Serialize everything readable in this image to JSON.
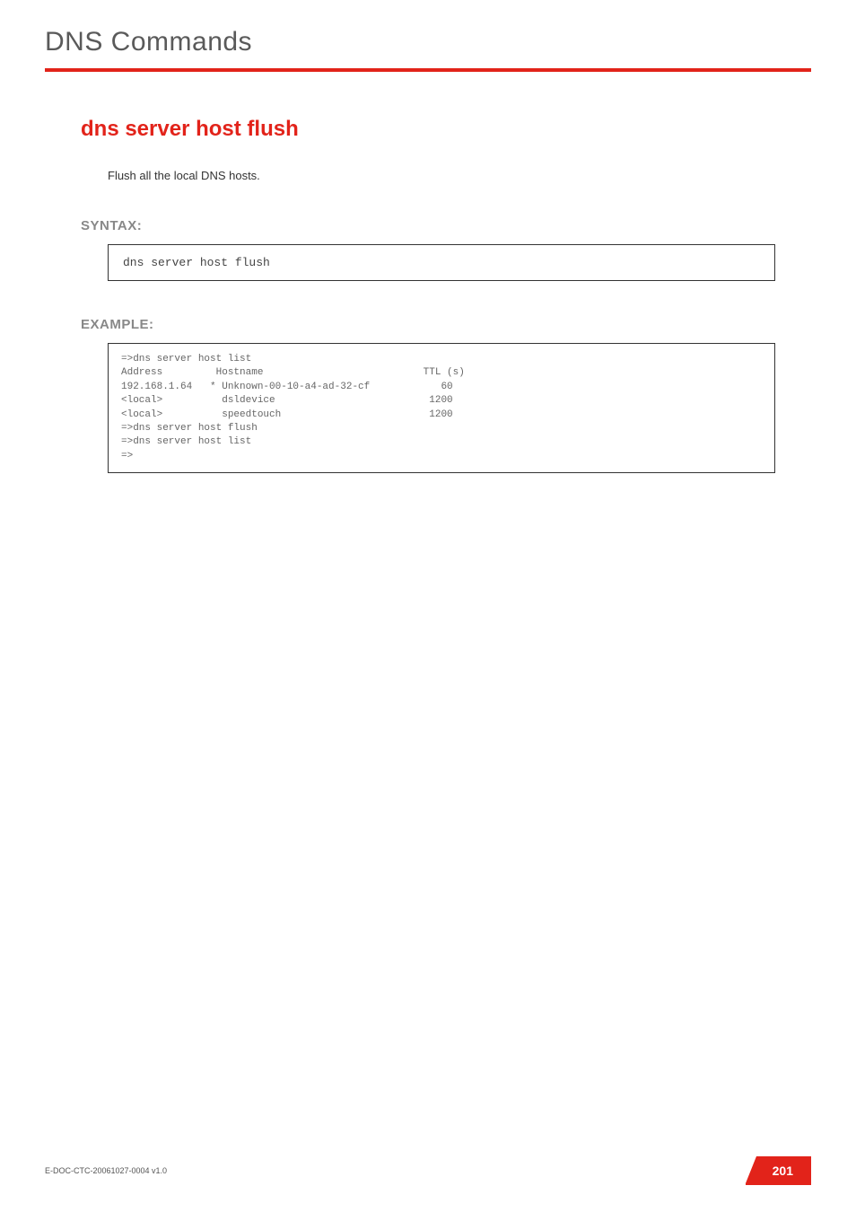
{
  "header": {
    "title": "DNS Commands"
  },
  "command": {
    "title": "dns server host flush",
    "description": "Flush all the local DNS hosts."
  },
  "syntax": {
    "label": "SYNTAX:",
    "content": "dns server host flush"
  },
  "example": {
    "label": "EXAMPLE:",
    "content": "=>dns server host list\nAddress         Hostname                           TTL (s)\n192.168.1.64   * Unknown-00-10-a4-ad-32-cf            60\n<local>          dsldevice                          1200\n<local>          speedtouch                         1200\n=>dns server host flush\n=>dns server host list\n=>"
  },
  "footer": {
    "doc_id": "E-DOC-CTC-20061027-0004 v1.0",
    "page_number": "201"
  }
}
